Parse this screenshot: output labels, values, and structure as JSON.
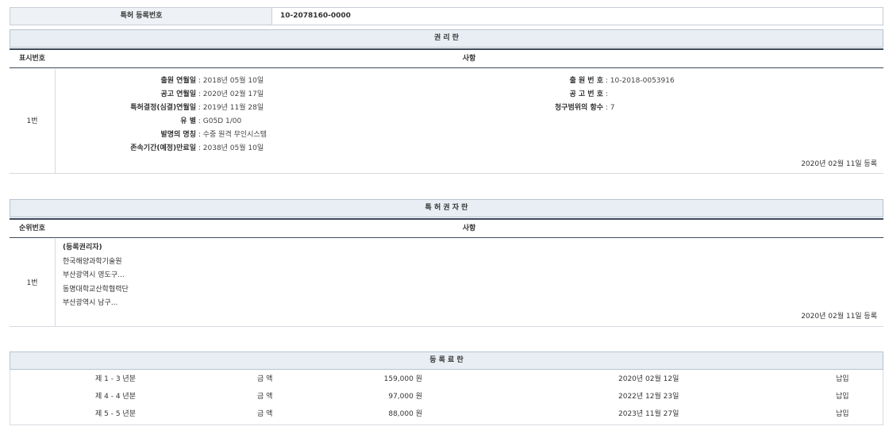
{
  "reg_header": {
    "label": "특허 등록번호",
    "number": "10-2078160-0000"
  },
  "rights_section": {
    "title": "권 리 란",
    "col_no": "표시번호",
    "col_items": "사항",
    "row": {
      "no": "1번",
      "left_fields": [
        {
          "label": "출원 연월일",
          "value": "2018년 05월 10일"
        },
        {
          "label": "공고 연월일",
          "value": "2020년 02월 17일"
        },
        {
          "label": "특허결정(심결)연월일",
          "value": "2019년 11월 28일"
        },
        {
          "label": "유 별",
          "value": "G05D 1/00"
        },
        {
          "label": "발명의 명칭",
          "value": "수중 원격 무인시스템"
        },
        {
          "label": "존속기간(예정)만료일",
          "value": "2038년 05월 10일"
        }
      ],
      "right_fields": [
        {
          "label": "출 원 번 호",
          "value": "10-2018-0053916"
        },
        {
          "label": "공 고 번 호",
          "value": ""
        },
        {
          "label": "청구범위의 항수",
          "value": "7"
        }
      ],
      "registered": "2020년 02월 11일 등록"
    }
  },
  "holder_section": {
    "title": "특 허 권 자 란",
    "col_no": "순위번호",
    "col_items": "사항",
    "row": {
      "no": "1번",
      "lines": [
        "(등록권리자)",
        "한국해양과학기술원",
        "부산광역시 영도구...",
        "동명대학교산학협력단",
        "부산광역시 남구..."
      ],
      "registered": "2020년 02월 11일 등록"
    }
  },
  "fees_section": {
    "title": "등 록 료 란",
    "rows": [
      {
        "period": "제 1 - 3 년분",
        "amount_label": "금 액",
        "amount": "159,000 원",
        "date": "2020년 02월 12일",
        "status": "납입"
      },
      {
        "period": "제 4 - 4 년분",
        "amount_label": "금 액",
        "amount": "97,000 원",
        "date": "2022년 12월 23일",
        "status": "납입"
      },
      {
        "period": "제 5 - 5 년분",
        "amount_label": "금 액",
        "amount": "88,000 원",
        "date": "2023년 11월 27일",
        "status": "납입"
      }
    ]
  }
}
